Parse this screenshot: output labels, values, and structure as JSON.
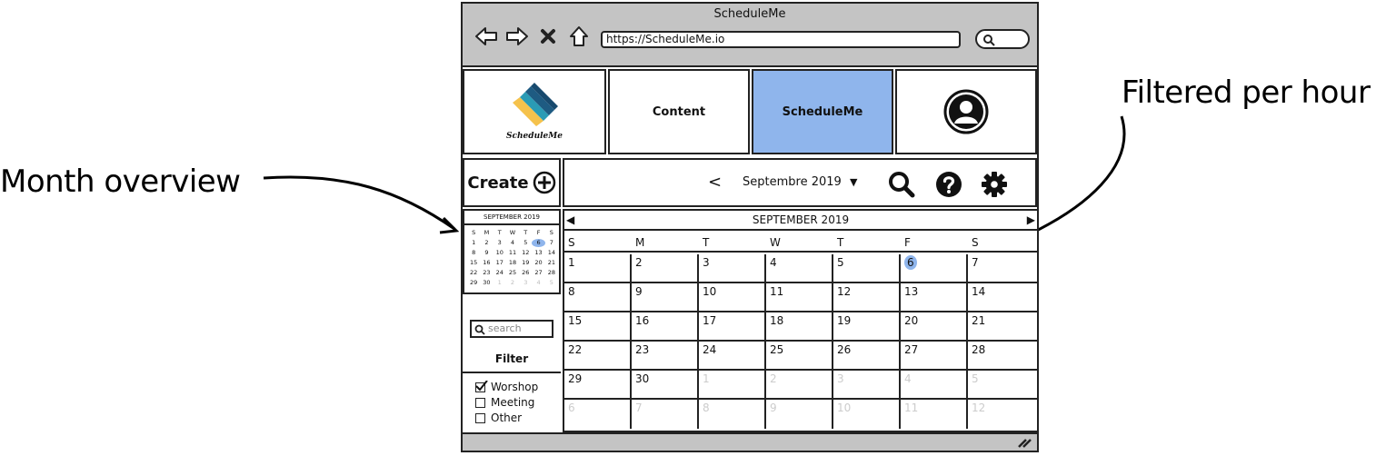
{
  "annotations": {
    "left_label": "Month overview",
    "right_label": "Filtered per hour"
  },
  "window": {
    "title": "ScheduleMe",
    "url": "https://ScheduleMe.io"
  },
  "header": {
    "logo_text": "ScheduleMe",
    "tab_content": "Content",
    "tab_schedule": "ScheduleMe",
    "active_color": "#8fb5ec"
  },
  "create": {
    "label": "Create"
  },
  "toolbar": {
    "month_label": "Septembre 2019",
    "prev_glyph": "<",
    "dropdown_glyph": "▼"
  },
  "mini_calendar": {
    "title": "SEPTEMBER 2019",
    "days": [
      "S",
      "M",
      "T",
      "W",
      "T",
      "F",
      "S"
    ],
    "dates": [
      "1",
      "2",
      "3",
      "4",
      "5",
      "6",
      "7",
      "8",
      "9",
      "10",
      "11",
      "12",
      "13",
      "14",
      "15",
      "16",
      "17",
      "18",
      "19",
      "20",
      "21",
      "22",
      "23",
      "24",
      "25",
      "26",
      "27",
      "28",
      "29",
      "30",
      "1",
      "2",
      "3",
      "4",
      "5"
    ],
    "today": "6"
  },
  "sidebar": {
    "search_placeholder": "search",
    "filter_title": "Filter",
    "filters": [
      {
        "label": "Worshop",
        "checked": true
      },
      {
        "label": "Meeting",
        "checked": false
      },
      {
        "label": "Other",
        "checked": false
      }
    ]
  },
  "calendar": {
    "title": "SEPTEMBER 2019",
    "prev_glyph": "◀",
    "next_glyph": "▶",
    "days": [
      "S",
      "M",
      "T",
      "W",
      "T",
      "F",
      "S"
    ],
    "weeks": [
      [
        "1",
        "2",
        "3",
        "4",
        "5",
        "6",
        "7"
      ],
      [
        "8",
        "9",
        "10",
        "11",
        "12",
        "13",
        "14"
      ],
      [
        "15",
        "16",
        "17",
        "18",
        "19",
        "20",
        "21"
      ],
      [
        "22",
        "23",
        "24",
        "25",
        "26",
        "27",
        "28"
      ],
      [
        "29",
        "30",
        "1",
        "2",
        "3",
        "4",
        "5"
      ],
      [
        "6",
        "7",
        "8",
        "9",
        "10",
        "11",
        "12"
      ]
    ],
    "today": "6"
  }
}
